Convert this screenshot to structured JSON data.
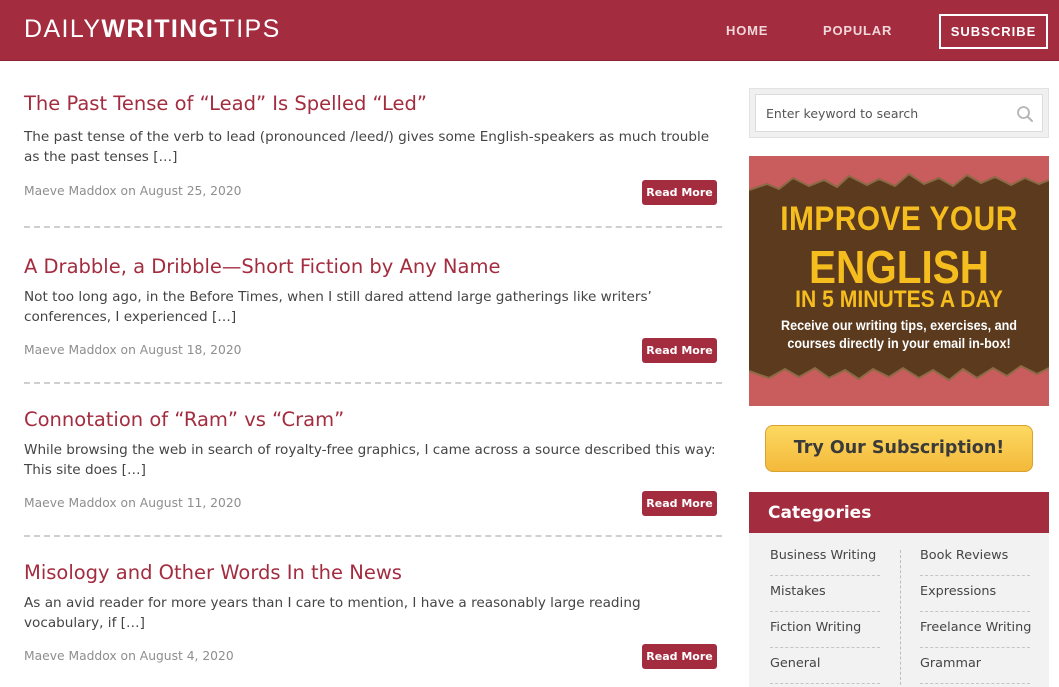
{
  "header": {
    "logo_part1": "DAILY",
    "logo_part2": "WRITING",
    "logo_part3": "TIPS",
    "nav": [
      "HOME",
      "POPULAR"
    ],
    "subscribe_label": "SUBSCRIBE"
  },
  "posts": [
    {
      "title": "The Past Tense of “Lead” Is Spelled “Led”",
      "excerpt": "The past tense of the verb to lead (pronounced /leed/) gives some English-speakers as much trouble as the past tenses […]",
      "meta": "Maeve Maddox on August 25, 2020",
      "read_more": "Read More"
    },
    {
      "title": "A Drabble, a Dribble—Short Fiction by Any Name",
      "excerpt": "Not too long ago, in the Before Times, when I still dared attend large gatherings like writers’ conferences, I experienced […]",
      "meta": "Maeve Maddox on August 18, 2020",
      "read_more": "Read More"
    },
    {
      "title": "Connotation of “Ram” vs “Cram”",
      "excerpt": "While browsing the web in search of royalty-free graphics, I came across a source described this way: This site does […]",
      "meta": "Maeve Maddox on August 11, 2020",
      "read_more": "Read More"
    },
    {
      "title": "Misology and Other Words In the News",
      "excerpt": "As an avid reader for more years than I care to mention, I have a reasonably large reading vocabulary, if […]",
      "meta": "Maeve Maddox on August 4, 2020",
      "read_more": "Read More"
    }
  ],
  "sidebar": {
    "search_placeholder": "Enter keyword to search",
    "promo": {
      "line1": "IMPROVE YOUR",
      "line2": "ENGLISH",
      "line3": "IN 5 MINUTES A DAY",
      "sub1": "Receive our writing tips, exercises, and",
      "sub2": "courses directly in your email in-box!"
    },
    "try_button": "Try Our Subscription!",
    "categories_title": "Categories",
    "categories_left": [
      "Business Writing",
      "Mistakes",
      "Fiction Writing",
      "General"
    ],
    "categories_right": [
      "Book Reviews",
      "Expressions",
      "Freelance Writing",
      "Grammar"
    ]
  },
  "colors": {
    "brand": "#a32c3f",
    "promo_gold": "#f6bd1e",
    "promo_brown": "#5b3a1e",
    "button_gold": "#fdd961"
  },
  "icons": [
    "search-icon"
  ]
}
